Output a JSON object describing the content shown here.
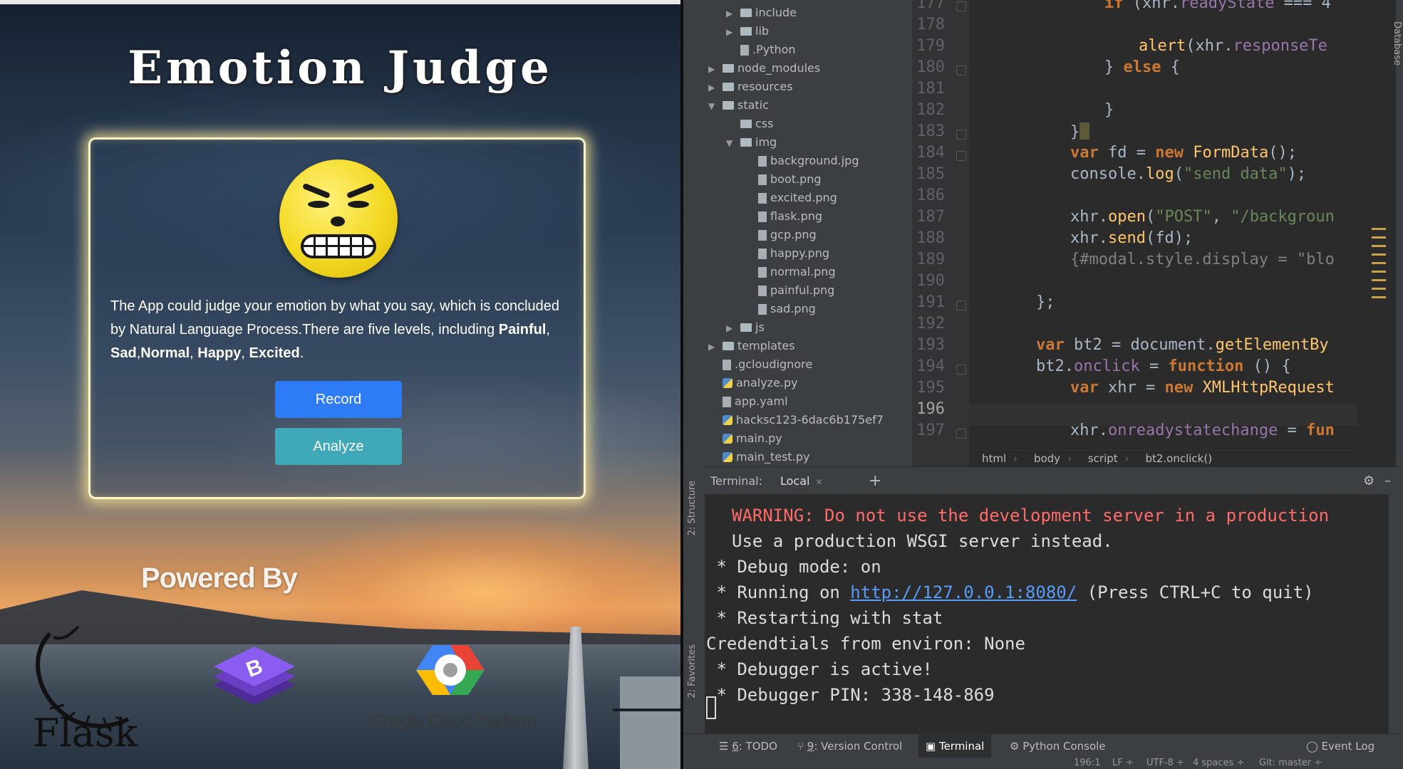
{
  "app": {
    "title": "Emotion Judge",
    "description_parts": [
      "The App could judge your emotion by what you say, which is concluded by Natural Language Process.There are five levels, including ",
      "Painful",
      ", ",
      "Sad",
      ",",
      "Normal",
      ", ",
      "Happy",
      ", ",
      "Excited",
      "."
    ],
    "record_label": "Record",
    "analyze_label": "Analyze",
    "powered_by": "Powered By",
    "logos": {
      "flask": "Flask",
      "gcp": "Google Cloud Platform",
      "bootstrap_letter": "B"
    }
  },
  "ide": {
    "tree": [
      {
        "depth": 2,
        "arrow": "▶",
        "icon": "folder",
        "name": "include"
      },
      {
        "depth": 2,
        "arrow": "▶",
        "icon": "folder",
        "name": "lib"
      },
      {
        "depth": 2,
        "arrow": "",
        "icon": "file",
        "name": ".Python"
      },
      {
        "depth": 1,
        "arrow": "▶",
        "icon": "folder",
        "name": "node_modules"
      },
      {
        "depth": 1,
        "arrow": "▶",
        "icon": "folder",
        "name": "resources"
      },
      {
        "depth": 1,
        "arrow": "▼",
        "icon": "folder",
        "name": "static"
      },
      {
        "depth": 2,
        "arrow": "",
        "icon": "folder",
        "name": "css"
      },
      {
        "depth": 2,
        "arrow": "▼",
        "icon": "folder",
        "name": "img"
      },
      {
        "depth": 3,
        "arrow": "",
        "icon": "file",
        "name": "background.jpg"
      },
      {
        "depth": 3,
        "arrow": "",
        "icon": "file",
        "name": "boot.png"
      },
      {
        "depth": 3,
        "arrow": "",
        "icon": "file",
        "name": "excited.png"
      },
      {
        "depth": 3,
        "arrow": "",
        "icon": "file",
        "name": "flask.png"
      },
      {
        "depth": 3,
        "arrow": "",
        "icon": "file",
        "name": "gcp.png"
      },
      {
        "depth": 3,
        "arrow": "",
        "icon": "file",
        "name": "happy.png"
      },
      {
        "depth": 3,
        "arrow": "",
        "icon": "file",
        "name": "normal.png"
      },
      {
        "depth": 3,
        "arrow": "",
        "icon": "file",
        "name": "painful.png"
      },
      {
        "depth": 3,
        "arrow": "",
        "icon": "file",
        "name": "sad.png"
      },
      {
        "depth": 2,
        "arrow": "▶",
        "icon": "folder",
        "name": "js"
      },
      {
        "depth": 1,
        "arrow": "▶",
        "icon": "folder",
        "name": "templates"
      },
      {
        "depth": 1,
        "arrow": "",
        "icon": "file",
        "name": ".gcloudignore"
      },
      {
        "depth": 1,
        "arrow": "",
        "icon": "py",
        "name": "analyze.py"
      },
      {
        "depth": 1,
        "arrow": "",
        "icon": "file",
        "name": "app.yaml"
      },
      {
        "depth": 1,
        "arrow": "",
        "icon": "py",
        "name": "hacksc123-6dac6b175ef7"
      },
      {
        "depth": 1,
        "arrow": "",
        "icon": "py",
        "name": "main.py"
      },
      {
        "depth": 1,
        "arrow": "",
        "icon": "py",
        "name": "main_test.py"
      }
    ],
    "line_numbers": [
      "177",
      "178",
      "179",
      "180",
      "181",
      "182",
      "183",
      "184",
      "185",
      "186",
      "187",
      "188",
      "189",
      "190",
      "191",
      "192",
      "193",
      "194",
      "195",
      "196",
      "197"
    ],
    "current_line": "196",
    "breadcrumb": [
      "html",
      "body",
      "script",
      "bt2.onclick()"
    ],
    "terminal_label": "Terminal:",
    "terminal_tab": "Local",
    "terminal_lines": [
      "WARNING: Do not use the development server in a production",
      "Use a production WSGI server instead.",
      " * Debug mode: on",
      " * Running on ",
      " * Restarting with stat",
      "Credendtials from environ: None",
      " * Debugger is active!",
      " * Debugger PIN: 338-148-869"
    ],
    "running_url": "http://127.0.0.1:8080/",
    "running_suffix": " (Press CTRL+C to quit)",
    "side_tabs": {
      "structure": "2: Structure",
      "favorites": "2: Favorites",
      "database": "Database"
    },
    "bottom_tabs": [
      {
        "num": "6",
        "label": ": TODO"
      },
      {
        "num": "9",
        "label": ": Version Control"
      },
      {
        "num": "",
        "label": "Terminal"
      },
      {
        "num": "",
        "label": "Python Console"
      }
    ],
    "event_log": "Event Log",
    "status": {
      "position": "196:1",
      "line_sep": "LF ÷",
      "encoding": "UTF-8 ÷",
      "indent": "4 spaces ÷",
      "git": "Git: master ÷"
    },
    "colors": {
      "keyword": "#cc7832",
      "function": "#ffc66d",
      "string": "#6a8759",
      "property": "#9876aa",
      "warning": "#ff6b68",
      "link": "#589df6"
    }
  }
}
